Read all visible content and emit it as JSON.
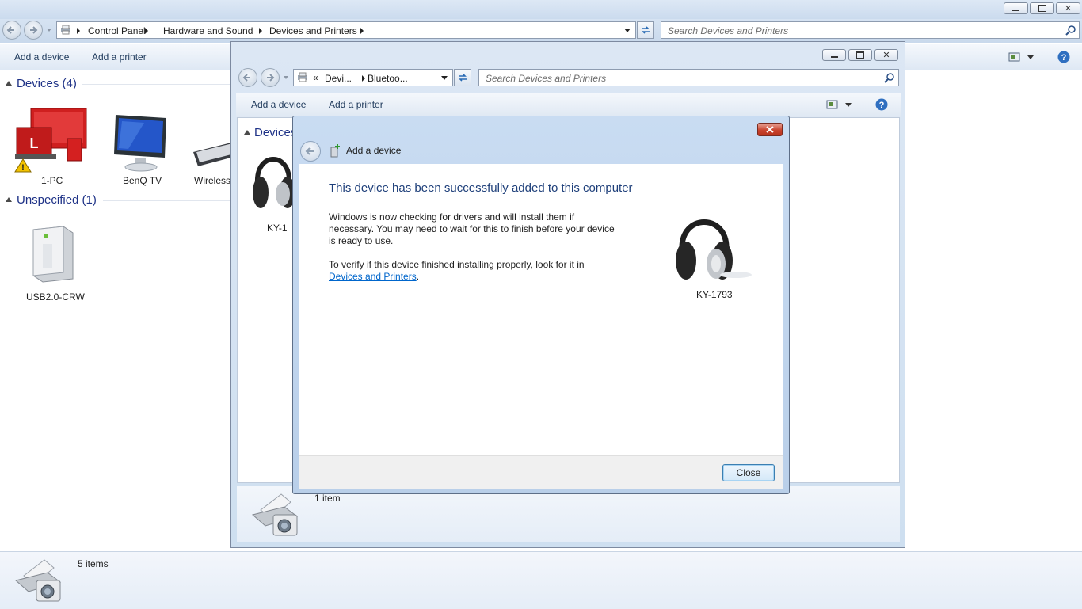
{
  "main": {
    "breadcrumb": [
      "Control Panel",
      "Hardware and Sound",
      "Devices and Printers"
    ],
    "search_placeholder": "Search Devices and Printers",
    "commands": {
      "add_device": "Add a device",
      "add_printer": "Add a printer"
    },
    "groups": {
      "devices": {
        "label": "Devices (4)",
        "items": [
          "1-PC",
          "BenQ TV",
          "Wireless"
        ]
      },
      "unspecified": {
        "label": "Unspecified (1)",
        "items": [
          "USB2.0-CRW"
        ]
      }
    },
    "status": "5 items"
  },
  "bt_window": {
    "breadcrumb": {
      "prefix": "«",
      "items": [
        "Devi...",
        "Bluetoo..."
      ]
    },
    "search_placeholder": "Search Devices and Printers",
    "commands": {
      "add_device": "Add a device",
      "add_printer": "Add a printer"
    },
    "group_label": "Devices",
    "device_label": "KY-1",
    "status": "1 item"
  },
  "wizard": {
    "title": "Add a device",
    "heading": "This device has been successfully added to this computer",
    "paragraph1": "Windows is now checking for drivers and will install them if necessary. You may need to wait for this to finish before your device is ready to use.",
    "paragraph2_prefix": "To verify if this device finished installing properly, look for it in",
    "paragraph2_link": "Devices and Printers",
    "paragraph2_suffix": ".",
    "device_name": "KY-1793",
    "close_label": "Close"
  },
  "colors": {
    "heading_blue": "#1e3f7a",
    "link_blue": "#0066cc",
    "close_red": "#c9442f"
  }
}
